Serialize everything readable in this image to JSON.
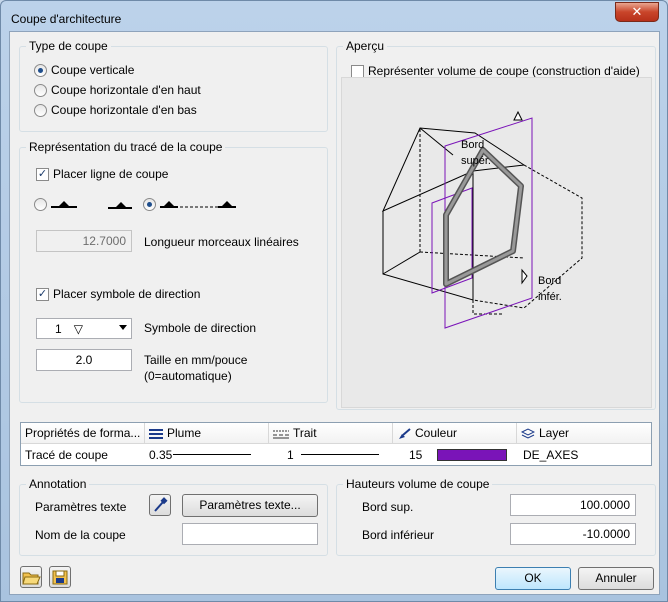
{
  "window": {
    "title": "Coupe d'architecture",
    "close_glyph": "✕"
  },
  "type_coupe": {
    "title": "Type de coupe",
    "options": [
      {
        "label": "Coupe verticale",
        "selected": true
      },
      {
        "label": "Coupe horizontale d'en haut",
        "selected": false
      },
      {
        "label": "Coupe horizontale d'en bas",
        "selected": false
      }
    ]
  },
  "representation": {
    "title": "Représentation du tracé de la coupe",
    "placer_ligne": {
      "label": "Placer ligne de coupe",
      "checked": true
    },
    "longueur": {
      "value": "12.7000",
      "label": "Longueur morceaux linéaires"
    },
    "placer_symbole": {
      "label": "Placer symbole de direction",
      "checked": true
    },
    "symbole": {
      "value": "1",
      "glyph": "▽",
      "label": "Symbole de direction"
    },
    "taille": {
      "value": "2.0",
      "label_line1": "Taille en mm/pouce",
      "label_line2": "(0=automatique)"
    }
  },
  "apercu": {
    "title": "Aperçu",
    "volume": {
      "label": "Représenter volume de coupe (construction d'aide)",
      "checked": false
    },
    "bord_sup_1": "Bord",
    "bord_sup_2": "supér.",
    "bord_inf_1": "Bord",
    "bord_inf_2": "infér."
  },
  "table": {
    "headers": [
      "Propriétés de forma...",
      "Plume",
      "Trait",
      "Couleur",
      "Layer"
    ],
    "row": {
      "name": "Tracé de coupe",
      "plume": "0.35",
      "trait": "1",
      "couleur": "15",
      "layer": "DE_AXES"
    },
    "color_hex": "#7a14b8"
  },
  "annotation": {
    "title": "Annotation",
    "parametres_label": "Paramètres texte",
    "parametres_button": "Paramètres texte...",
    "nom_label": "Nom de la coupe",
    "nom_value": ""
  },
  "hauteurs": {
    "title": "Hauteurs volume de coupe",
    "bord_sup_label": "Bord sup.",
    "bord_sup_value": "100.0000",
    "bord_inf_label": "Bord inférieur",
    "bord_inf_value": "-10.0000"
  },
  "buttons": {
    "ok": "OK",
    "cancel": "Annuler"
  }
}
